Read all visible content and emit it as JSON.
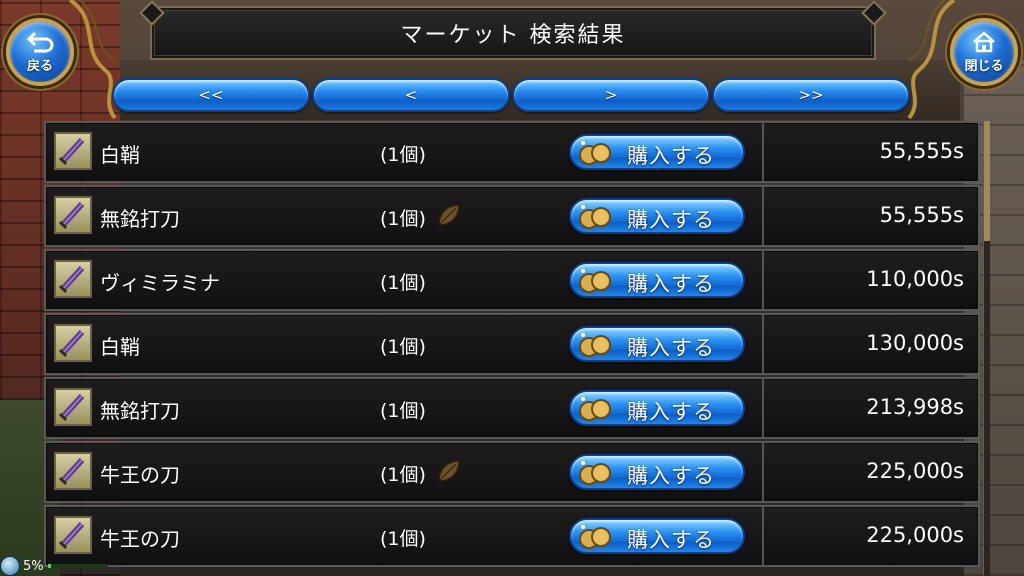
{
  "title": "マーケット 検索結果",
  "back_button": {
    "label": "戻る",
    "icon": "back-arrow-icon"
  },
  "close_button": {
    "label": "閉じる",
    "icon": "home-icon"
  },
  "pagination": {
    "first": "<<",
    "prev": "<",
    "next": ">",
    "last": ">>"
  },
  "buy_label": "購入する",
  "listings": [
    {
      "name": "白鞘",
      "qty": "(1個)",
      "leaf": false,
      "price": "55,555s"
    },
    {
      "name": "無銘打刀",
      "qty": "(1個)",
      "leaf": true,
      "price": "55,555s"
    },
    {
      "name": "ヴィミラミナ",
      "qty": "(1個)",
      "leaf": false,
      "price": "110,000s"
    },
    {
      "name": "白鞘",
      "qty": "(1個)",
      "leaf": false,
      "price": "130,000s"
    },
    {
      "name": "無銘打刀",
      "qty": "(1個)",
      "leaf": false,
      "price": "213,998s"
    },
    {
      "name": "牛王の刀",
      "qty": "(1個)",
      "leaf": true,
      "price": "225,000s"
    },
    {
      "name": "牛王の刀",
      "qty": "(1個)",
      "leaf": false,
      "price": "225,000s"
    }
  ],
  "status": {
    "percent": "5%",
    "fill_fraction": 0.05
  },
  "colors": {
    "button_blue": "#2a8ff0",
    "gold_trim": "#c9a24a",
    "row_bg": "#151515"
  },
  "icons": {
    "item": "sword-item-icon",
    "leaf": "leaf-icon",
    "coins": "coins-icon"
  }
}
